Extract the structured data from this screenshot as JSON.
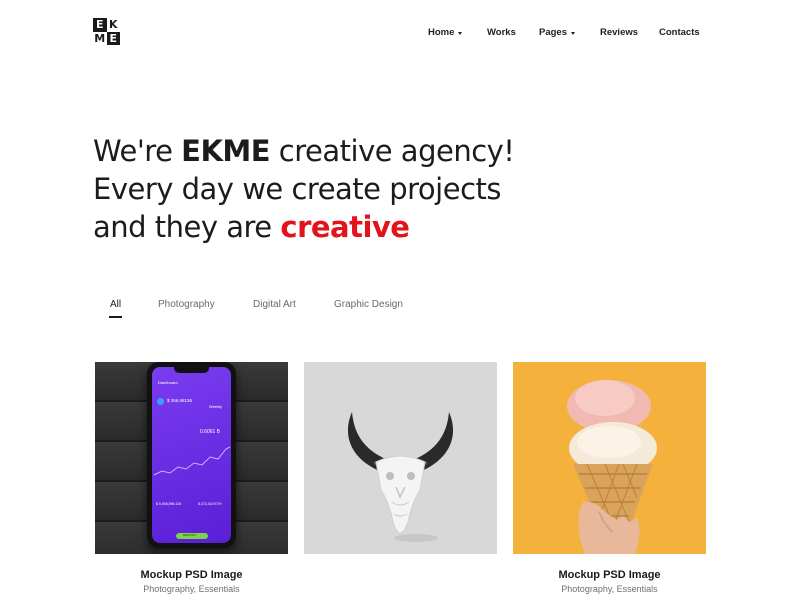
{
  "brand": {
    "logo_letters": [
      "E",
      "K",
      "M",
      "E"
    ]
  },
  "nav": {
    "items": [
      {
        "label": "Home",
        "dropdown": true
      },
      {
        "label": "Works",
        "dropdown": false
      },
      {
        "label": "Pages",
        "dropdown": true
      },
      {
        "label": "Reviews",
        "dropdown": false
      },
      {
        "label": "Contacts",
        "dropdown": false
      }
    ]
  },
  "hero": {
    "line1_prefix": "We're ",
    "line1_bold": "EKME",
    "line1_suffix": " creative agency!",
    "line2": "Every day we create projects",
    "line3_prefix": "and they are ",
    "line3_accent": "creative",
    "accent_color": "#e3131a"
  },
  "filters": {
    "items": [
      "All",
      "Photography",
      "Digital Art",
      "Graphic Design"
    ],
    "active": "All"
  },
  "portfolio": {
    "cards": [
      {
        "title": "Mockup PSD Image",
        "subtitle": "Photography, Essentials",
        "image": "phone-dashboard-mockup",
        "screen": {
          "header": "Dashboard",
          "amount": "$ 356,68136",
          "period": "Weekly",
          "stat": "0.6061 B",
          "foot_left": "$ 5,065,596.105",
          "foot_right": "8,472,419 ETH",
          "button": "DEPOSIT"
        }
      },
      {
        "title": "",
        "subtitle": "",
        "image": "bull-skull-photo"
      },
      {
        "title": "Mockup PSD Image",
        "subtitle": "Photography, Essentials",
        "image": "ice-cream-cone-photo"
      }
    ]
  }
}
